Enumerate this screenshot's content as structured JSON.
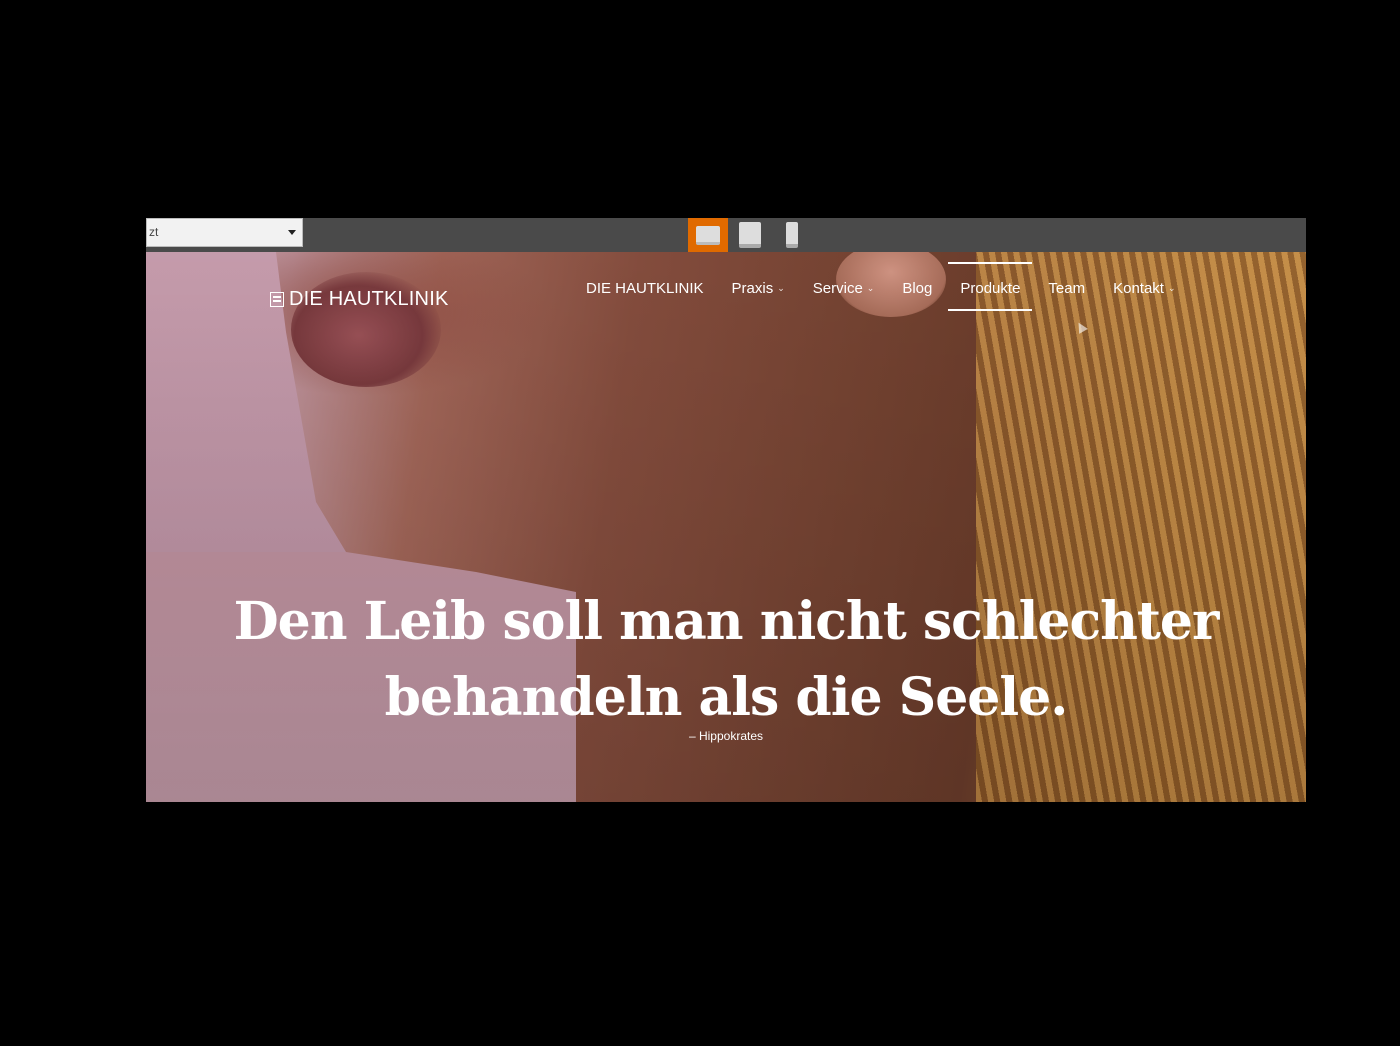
{
  "editor_toolbar": {
    "page_select_value": "zt",
    "device_buttons": [
      {
        "name": "desktop",
        "active": true
      },
      {
        "name": "tablet",
        "active": false
      },
      {
        "name": "mobile",
        "active": false
      }
    ],
    "accent_color": "#e06a00"
  },
  "header": {
    "logo_text": "DIE HAUTKLINIK",
    "logo_icon": "book-icon",
    "nav": [
      {
        "label": "DIE HAUTKLINIK",
        "dropdown": false
      },
      {
        "label": "Praxis",
        "dropdown": true
      },
      {
        "label": "Service",
        "dropdown": true
      },
      {
        "label": "Blog",
        "dropdown": false
      },
      {
        "label": "Produkte",
        "dropdown": false,
        "hovered": true
      },
      {
        "label": "Team",
        "dropdown": false
      },
      {
        "label": "Kontakt",
        "dropdown": true
      }
    ]
  },
  "hero": {
    "quote_line1": "Den Leib soll man nicht schlechter",
    "quote_line2": "behandeln als die Seele.",
    "author": "– Hippokrates"
  }
}
